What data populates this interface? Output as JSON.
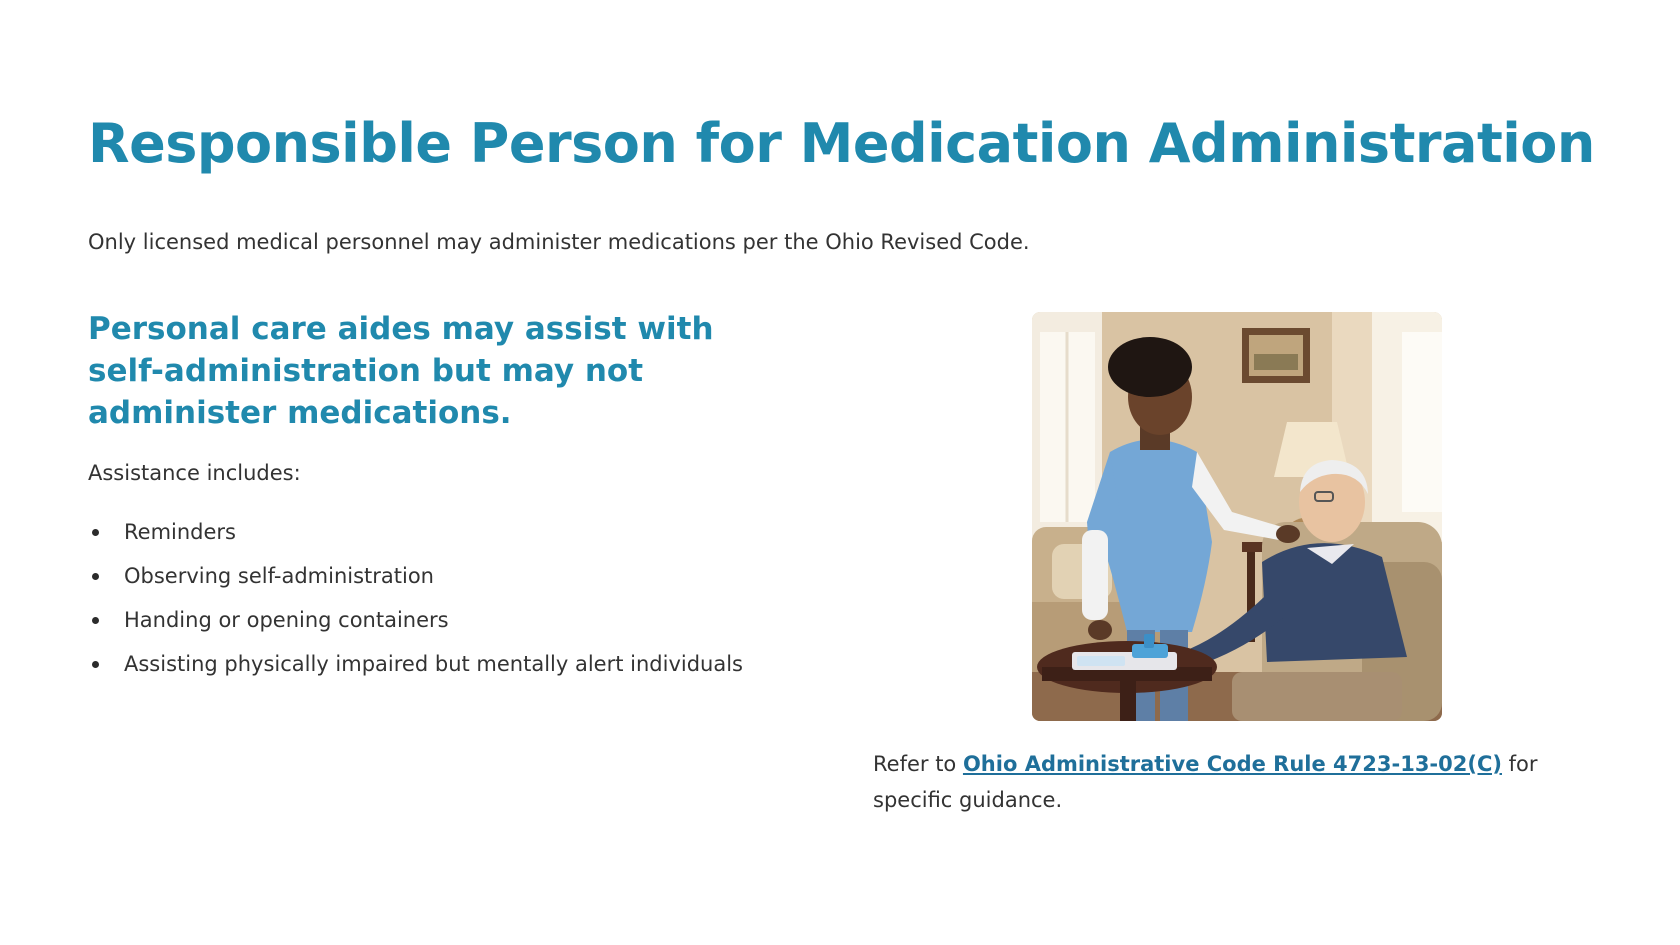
{
  "title": "Responsible Person for Medication Administration",
  "intro": "Only licensed medical personnel may administer medications per the Ohio Revised Code.",
  "subheading": "Personal care aides may assist with self-administration but may not administer medications.",
  "assistance_label": "Assistance includes:",
  "bullets": [
    "Reminders",
    "Observing self-administration",
    "Handing or opening containers",
    "Assisting physically impaired but mentally alert individuals"
  ],
  "reference": {
    "prefix": "Refer to ",
    "link_text": "Ohio Administrative Code Rule 4723-13-02(C)",
    "suffix": " for specific guidance."
  },
  "image": {
    "subject": "caregiver-assisting-elderly-man-with-medication-photo"
  },
  "colors": {
    "heading": "#2089ad",
    "link": "#1f6f9a",
    "body_text": "#333333",
    "background": "#ffffff"
  }
}
